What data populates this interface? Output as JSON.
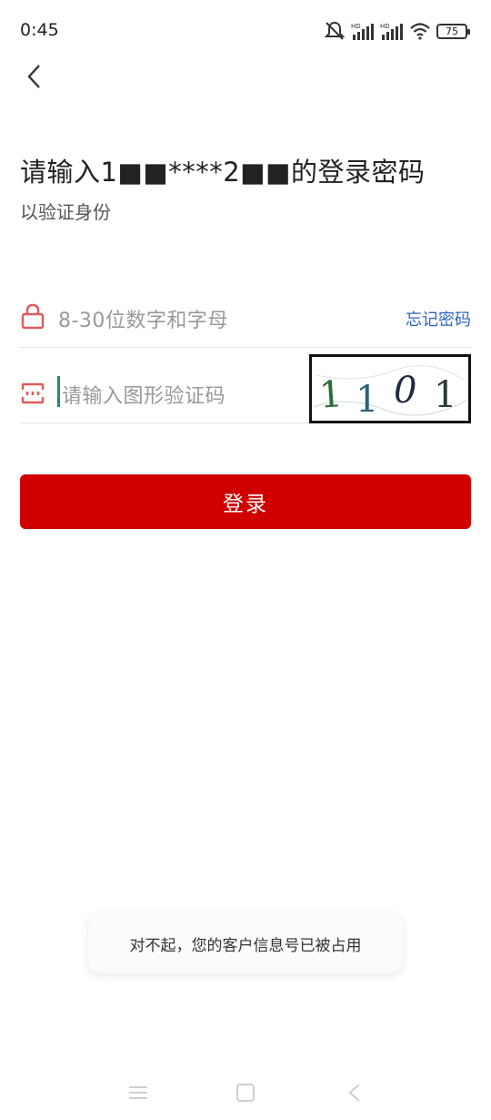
{
  "status": {
    "time": "0:45",
    "battery": "75",
    "icons": [
      "mute-icon",
      "hd-signal-icon",
      "hd-signal-icon",
      "wifi-icon",
      "battery-icon"
    ]
  },
  "header": {
    "title": "请输入1■■****2■■的登录密码",
    "subtitle": "以验证身份"
  },
  "password": {
    "placeholder": "8-30位数字和字母",
    "forgot_label": "忘记密码",
    "icon": "lock-icon"
  },
  "captcha": {
    "placeholder": "请输入图形验证码",
    "image_text": "1101",
    "icon": "captcha-icon"
  },
  "login_button": "登录",
  "toast": "对不起，您的客户信息号已被占用",
  "colors": {
    "primary_red": "#d10000",
    "icon_red": "#e05a5a",
    "link_blue": "#2b65c4",
    "cursor_green": "#1f8a78"
  }
}
